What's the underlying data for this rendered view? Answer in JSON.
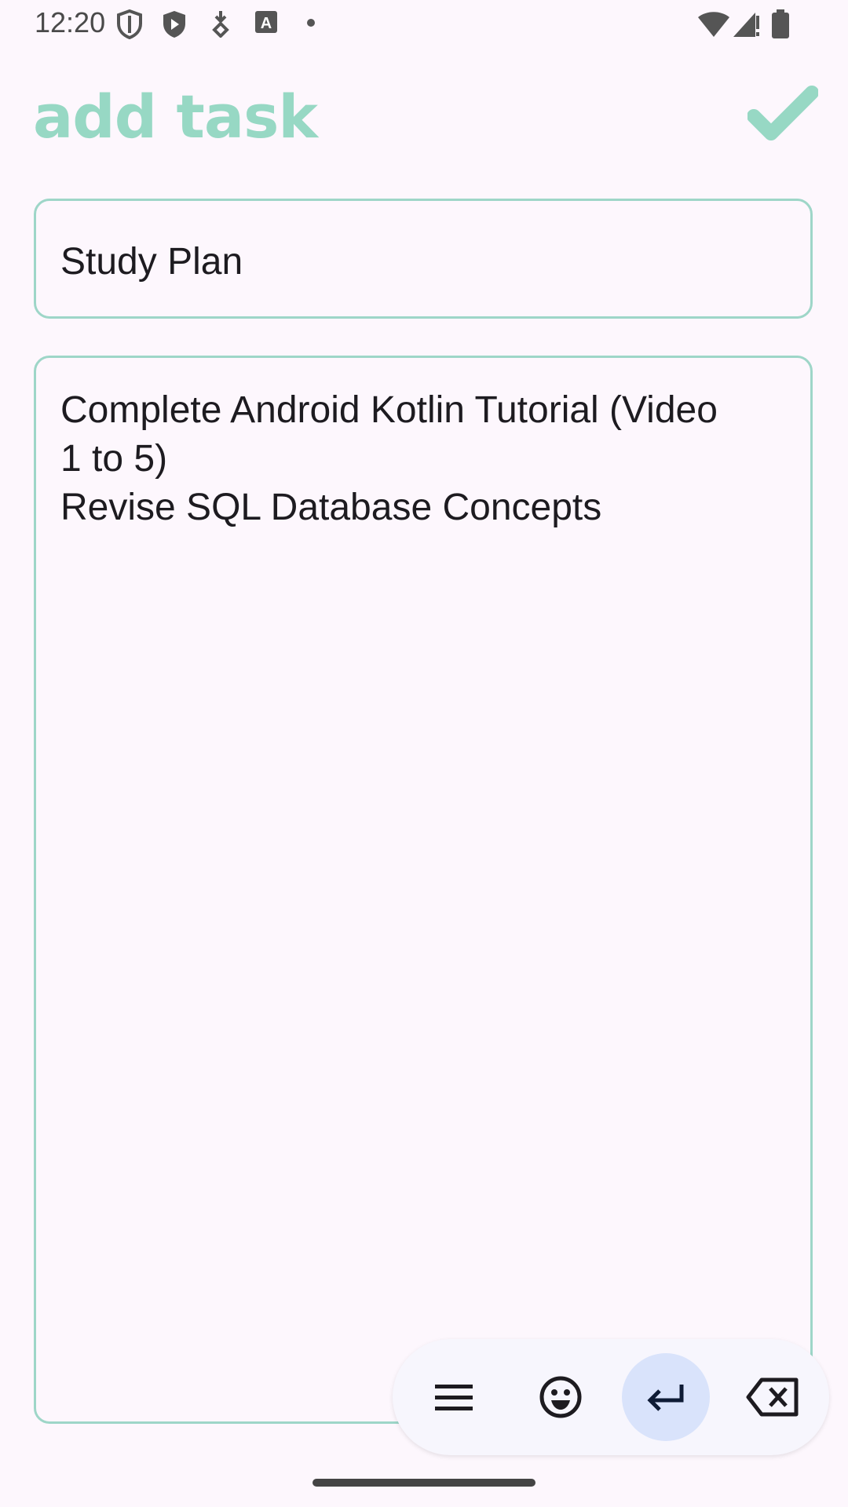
{
  "status_bar": {
    "time": "12:20",
    "icons": [
      "shield-outline-icon",
      "shield-play-icon",
      "download-icon",
      "font-a-icon",
      "dot-icon",
      "wifi-icon",
      "cell-signal-icon",
      "battery-icon"
    ]
  },
  "header": {
    "title": "add task",
    "confirm_icon": "checkmark-icon"
  },
  "form": {
    "title_value": "Study Plan",
    "body_lines": [
      "Complete Android Kotlin Tutorial (Video",
      "1 to 5)",
      "Revise SQL Database Concepts"
    ]
  },
  "keyboard_toolbar": {
    "buttons": [
      "menu-icon",
      "emoji-icon",
      "enter-icon",
      "backspace-icon"
    ],
    "active": "enter-icon"
  },
  "colors": {
    "accent": "#97d8c4",
    "field_border": "#9ed6c8",
    "background": "#fdf7fd",
    "active_key_bg": "#d9e3fb"
  }
}
